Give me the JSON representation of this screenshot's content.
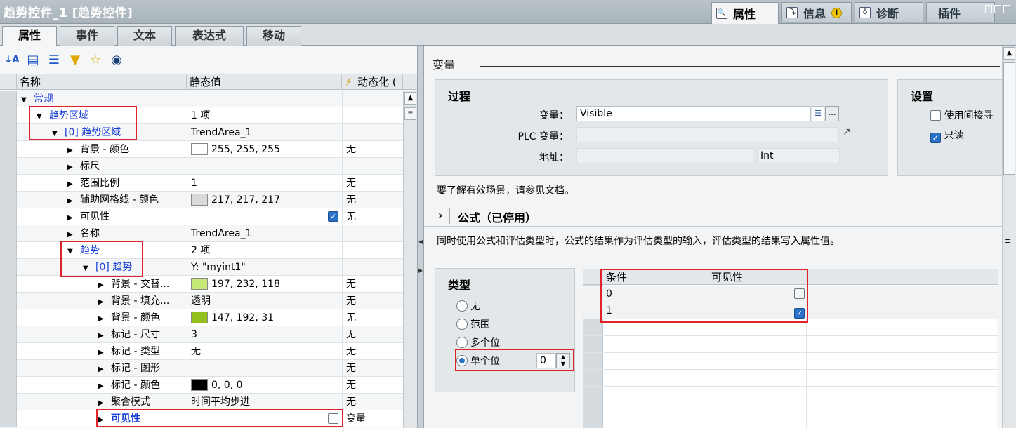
{
  "window": {
    "title": "趋势控件_1 [趋势控件]"
  },
  "inspector_tabs": [
    {
      "label": "属性",
      "icon": "properties-icon"
    },
    {
      "label": "信息",
      "icon": "info-icon"
    },
    {
      "label": "诊断",
      "icon": "diagnostics-icon"
    },
    {
      "label": "插件",
      "icon": ""
    }
  ],
  "prop_tabs": [
    "属性",
    "事件",
    "文本",
    "表达式",
    "移动"
  ],
  "toolbar": [
    "sort-az-icon",
    "expand-icon",
    "collapse-icon",
    "filter-icon",
    "star-icon",
    "eye-icon"
  ],
  "table": {
    "headers": {
      "name": "名称",
      "static": "静态值",
      "dynamic": "动态化 ("
    },
    "rows": [
      {
        "name": "常规",
        "value": "",
        "dyn": ""
      },
      {
        "name": "趋势区域",
        "value": "1 项",
        "dyn": ""
      },
      {
        "name": "[0] 趋势区域",
        "value": "TrendArea_1",
        "dyn": ""
      },
      {
        "name": "背景 - 颜色",
        "value": "255, 255, 255",
        "dyn": "无",
        "color": "#ffffff"
      },
      {
        "name": "标尺",
        "value": "",
        "dyn": ""
      },
      {
        "name": "范围比例",
        "value": "1",
        "dyn": "无"
      },
      {
        "name": "辅助网格线 - 颜色",
        "value": "217, 217, 217",
        "dyn": "无",
        "color": "#d9d9d9"
      },
      {
        "name": "可见性",
        "value": "",
        "dyn": "无"
      },
      {
        "name": "名称",
        "value": "TrendArea_1",
        "dyn": ""
      },
      {
        "name": "趋势",
        "value": "2 项",
        "dyn": ""
      },
      {
        "name": "[0] 趋势",
        "value": "Y: \"myint1\"",
        "dyn": ""
      },
      {
        "name": "背景 - 交替...",
        "value": "197, 232, 118",
        "dyn": "无",
        "color": "#c5e876"
      },
      {
        "name": "背景 - 填充...",
        "value": "透明",
        "dyn": "无"
      },
      {
        "name": "背景 - 颜色",
        "value": "147, 192, 31",
        "dyn": "无",
        "color": "#93c01f"
      },
      {
        "name": "标记 - 尺寸",
        "value": "3",
        "dyn": "无"
      },
      {
        "name": "标记 - 类型",
        "value": "无",
        "dyn": "无"
      },
      {
        "name": "标记 - 图形",
        "value": "",
        "dyn": "无"
      },
      {
        "name": "标记 - 颜色",
        "value": "0, 0, 0",
        "dyn": "无",
        "color": "#000000"
      },
      {
        "name": "聚合模式",
        "value": "时间平均步进",
        "dyn": "无"
      },
      {
        "name": "可见性",
        "value": "",
        "dyn": "变量"
      }
    ]
  },
  "right": {
    "section_variable": "变量",
    "process": {
      "title": "过程",
      "variable_label": "变量：",
      "variable_value": "Visible",
      "plc_label": "PLC 变量：",
      "plc_value": "",
      "address_label": "地址：",
      "address_value": "",
      "type_value": "Int"
    },
    "settings": {
      "title": "设置",
      "indirect": "使用间接寻",
      "readonly": "只读"
    },
    "hint": "要了解有效场景，请参见文档。",
    "formula_title": "公式（已停用）",
    "formula_desc": "同时使用公式和评估类型时，公式的结果作为评估类型的输入，评估类型的结果写入属性值。",
    "type_box": {
      "title": "类型",
      "options": [
        "无",
        "范围",
        "多个位",
        "单个位"
      ],
      "selected": "单个位",
      "bit_value": "0"
    },
    "grid": {
      "headers": [
        "条件",
        "可见性"
      ],
      "rows": [
        {
          "cond": "0",
          "visible": false
        },
        {
          "cond": "1",
          "visible": true
        }
      ]
    }
  }
}
